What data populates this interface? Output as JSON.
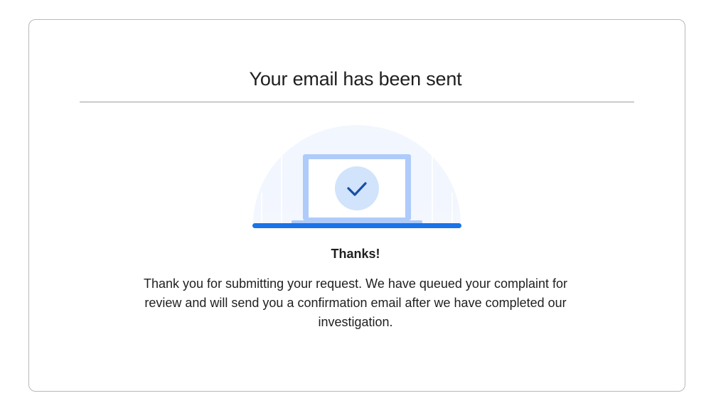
{
  "dialog": {
    "title": "Your email has been sent",
    "heading": "Thanks!",
    "message": "Thank you for submitting your request. We have queued your complaint for review and will send you a confirmation email after we have completed our investigation.",
    "illustration_icon": "laptop-checkmark-icon"
  },
  "colors": {
    "accent_blue": "#1a73e8",
    "light_blue": "#aecbfa",
    "pale_blue": "#d2e3fc",
    "check_color": "#174ea6"
  }
}
